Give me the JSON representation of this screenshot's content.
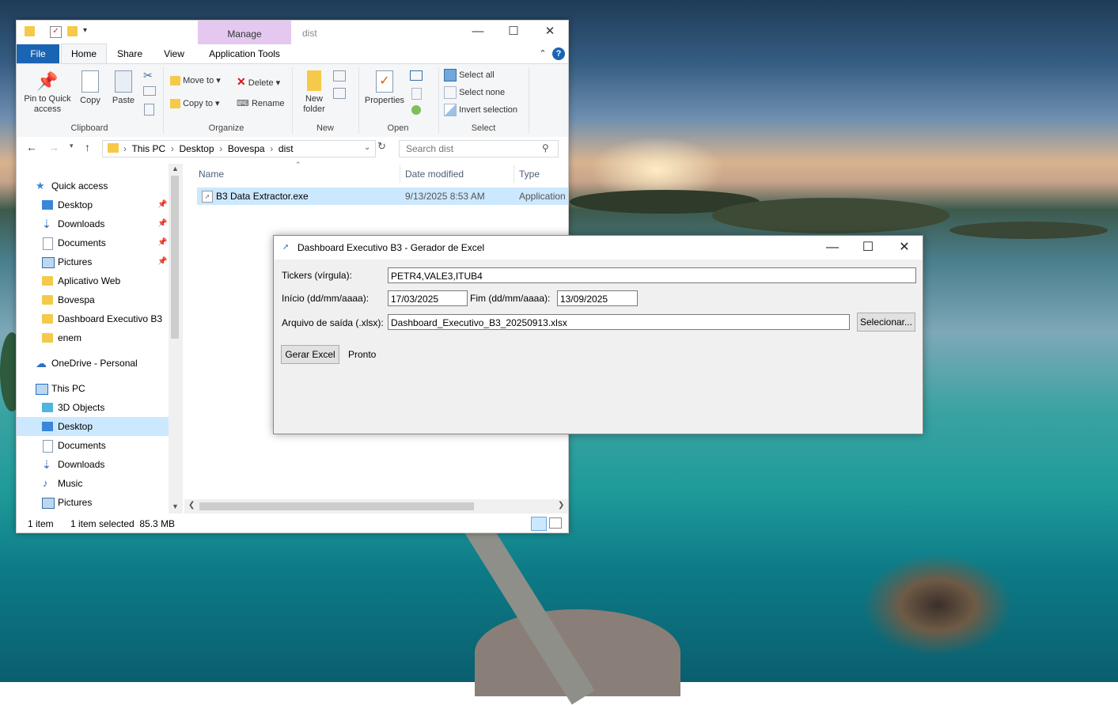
{
  "explorer": {
    "title": "dist",
    "manage_tab": "Manage",
    "tabs": {
      "file": "File",
      "home": "Home",
      "share": "Share",
      "view": "View",
      "app_tools": "Application Tools"
    },
    "ribbon": {
      "pin": "Pin to Quick access",
      "copy": "Copy",
      "paste": "Paste",
      "clipboard_group": "Clipboard",
      "move_to": "Move to",
      "copy_to": "Copy to",
      "delete": "Delete",
      "rename": "Rename",
      "organize_group": "Organize",
      "new_folder": "New folder",
      "new_group": "New",
      "properties": "Properties",
      "open_group": "Open",
      "select_all": "Select all",
      "select_none": "Select none",
      "invert_selection": "Invert selection",
      "select_group": "Select"
    },
    "address": {
      "crumbs": [
        "This PC",
        "Desktop",
        "Bovespa",
        "dist"
      ]
    },
    "search_placeholder": "Search dist",
    "nav": {
      "quick_access": "Quick access",
      "items": [
        "Desktop",
        "Downloads",
        "Documents",
        "Pictures",
        "Aplicativo Web",
        "Bovespa",
        "Dashboard Executivo B3",
        "enem"
      ],
      "onedrive": "OneDrive - Personal",
      "this_pc": "This PC",
      "pc_items": [
        "3D Objects",
        "Desktop",
        "Documents",
        "Downloads",
        "Music",
        "Pictures"
      ]
    },
    "columns": {
      "name": "Name",
      "date": "Date modified",
      "type": "Type"
    },
    "files": [
      {
        "name": "B3 Data Extractor.exe",
        "date": "9/13/2025 8:53 AM",
        "type": "Application"
      }
    ],
    "status": {
      "count": "1 item",
      "selected": "1 item selected  85.3 MB"
    }
  },
  "dialog": {
    "title": "Dashboard Executivo B3 - Gerador de Excel",
    "tickers_label": "Tickers (vírgula):",
    "tickers_value": "PETR4,VALE3,ITUB4",
    "start_label": "Início (dd/mm/aaaa):",
    "start_value": "17/03/2025",
    "end_label": "Fim (dd/mm/aaaa):",
    "end_value": "13/09/2025",
    "output_label": "Arquivo de saída (.xlsx):",
    "output_value": "Dashboard_Executivo_B3_20250913.xlsx",
    "select_button": "Selecionar...",
    "generate_button": "Gerar Excel",
    "status": "Pronto"
  }
}
